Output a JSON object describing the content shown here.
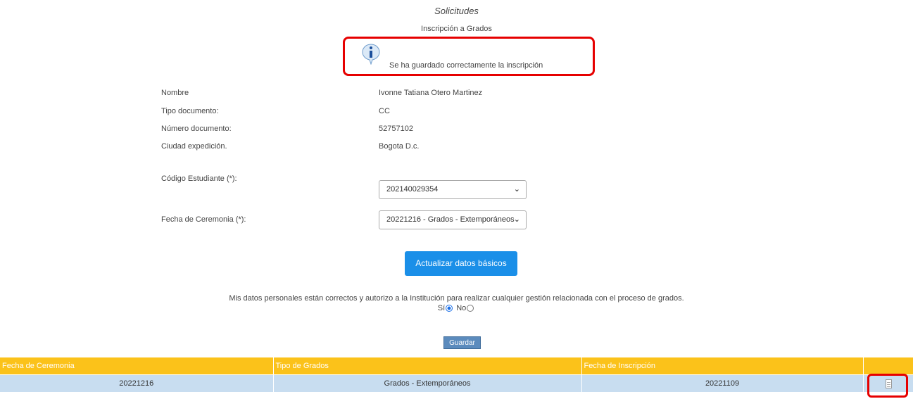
{
  "header": {
    "title": "Solicitudes",
    "subtitle": "Inscripción a Grados"
  },
  "message": {
    "icon": "info-icon",
    "text": "Se ha guardado correctamente la inscripción"
  },
  "person": {
    "nombre_label": "Nombre",
    "nombre_value": "Ivonne Tatiana Otero Martinez",
    "tipo_doc_label": "Tipo documento:",
    "tipo_doc_value": "CC",
    "num_doc_label": "Número documento:",
    "num_doc_value": "52757102",
    "ciudad_label": "Ciudad expedición.",
    "ciudad_value": "Bogota D.c."
  },
  "form": {
    "codigo_label": "Código Estudiante (*):",
    "codigo_value": "202140029354",
    "fecha_label": "Fecha de Ceremonia (*):",
    "fecha_value": "20221216 - Grados - Extemporáneos",
    "update_button": "Actualizar datos básicos",
    "consent_text": "Mis datos personales están correctos y autorizo a la Institución para realizar cualquier gestión relacionada con el proceso de grados.",
    "radio_yes": "Sí",
    "radio_no": "No",
    "radio_selected": "Sí",
    "save_button": "Guardar"
  },
  "table": {
    "headers": [
      "Fecha de Ceremonia",
      "Tipo de Grados",
      "Fecha de Inscripción",
      ""
    ],
    "rows": [
      [
        "20221216",
        "Grados - Extemporáneos",
        "20221109",
        ""
      ]
    ]
  },
  "colors": {
    "accent": "#1a8fe8",
    "table_header": "#fbc21a",
    "table_row": "#c8ddf0",
    "highlight": "#e60000"
  }
}
